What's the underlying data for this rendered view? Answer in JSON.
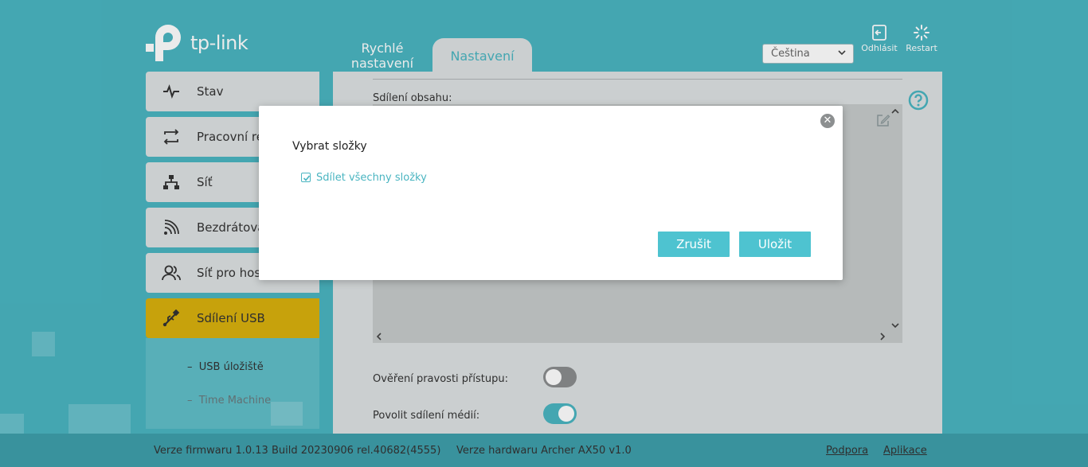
{
  "header": {
    "logo_text": "tp-link",
    "tabs": [
      {
        "label": "Rychlé nastavení",
        "line1": "Rychlé",
        "line2": "nastavení",
        "active": false
      },
      {
        "label": "Nastavení",
        "active": true
      }
    ],
    "language": {
      "selected": "Čeština"
    },
    "actions": {
      "logout": "Odhlásit",
      "restart": "Restart"
    }
  },
  "sidebar": {
    "items": [
      {
        "label": "Stav",
        "icon": "pulse-icon"
      },
      {
        "label": "Pracovní re",
        "icon": "swap-arrows-icon"
      },
      {
        "label": "Síť",
        "icon": "network-icon"
      },
      {
        "label": "Bezdrátová",
        "icon": "wireless-icon"
      },
      {
        "label": "Síť pro hos",
        "icon": "guest-users-icon"
      },
      {
        "label": "Sdílení USB",
        "icon": "usb-icon",
        "active": true
      }
    ],
    "subitems": [
      {
        "label": "USB úložiště",
        "active": true
      },
      {
        "label": "Time Machine",
        "active": false
      }
    ],
    "sub_bullet": "–"
  },
  "main": {
    "share_label": "Sdílení obsahu:",
    "auth_label": "Ověření pravosti přístupu:",
    "auth_enabled": false,
    "media_label": "Povolit sdílení médií:",
    "media_enabled": true
  },
  "modal": {
    "title": "Vybrat složky",
    "share_all_label": "Sdílet všechny složky",
    "share_all_checked": true,
    "cancel_label": "Zrušit",
    "save_label": "Uložit"
  },
  "footer": {
    "firmware": "Verze firmwaru 1.0.13 Build 20230906 rel.40682(4555)",
    "hardware": "Verze hardwaru Archer AX50 v1.0",
    "support": "Podpora",
    "apps": "Aplikace"
  },
  "colors": {
    "background": "#4ab5c1",
    "panel": "#dde1e2",
    "active_sidebar": "#d8b00e",
    "button": "#4ec3d0"
  }
}
